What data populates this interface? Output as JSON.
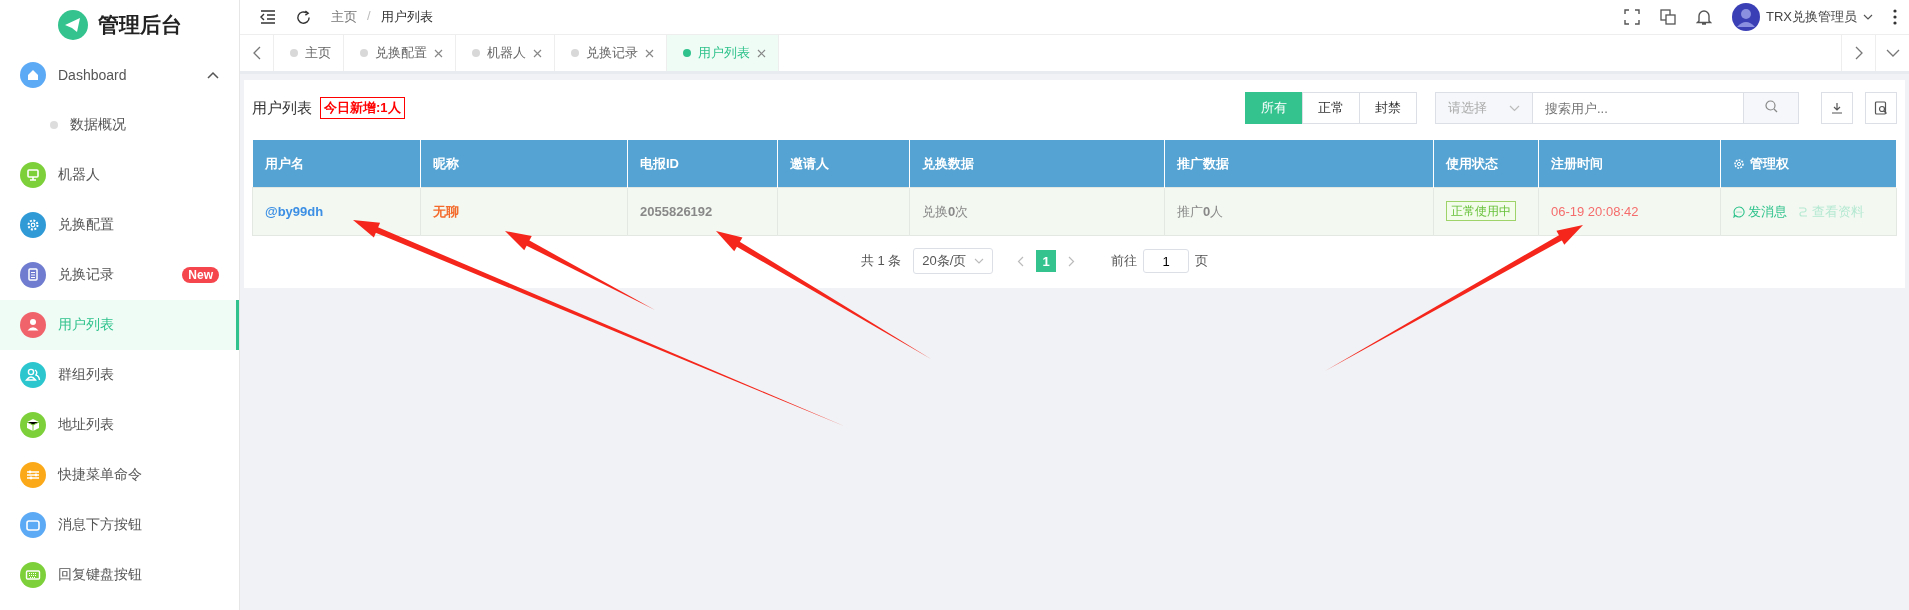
{
  "sidebar": {
    "logo": "管理后台",
    "items": [
      {
        "label": "Dashboard",
        "kind": "home",
        "color": "#5ca9f5",
        "selected": false,
        "expanded": true,
        "children": [
          {
            "label": "数据概况",
            "selected": false
          }
        ]
      },
      {
        "label": "机器人",
        "kind": "monitor",
        "color": "#7dd03a",
        "selected": false
      },
      {
        "label": "兑换配置",
        "kind": "gear",
        "color": "#2f9ad6",
        "selected": false
      },
      {
        "label": "兑换记录",
        "kind": "doc",
        "color": "#6f7ccf",
        "selected": false,
        "badge": "New"
      },
      {
        "label": "用户列表",
        "kind": "user",
        "color": "#f0636b",
        "selected": true
      },
      {
        "label": "群组列表",
        "kind": "users",
        "color": "#2cc6cf",
        "selected": false
      },
      {
        "label": "地址列表",
        "kind": "cube",
        "color": "#7dd03a",
        "selected": false
      },
      {
        "label": "快捷菜单命令",
        "kind": "sliders",
        "color": "#fba919",
        "selected": false
      },
      {
        "label": "消息下方按钮",
        "kind": "wallet",
        "color": "#5ca9f5",
        "selected": false
      },
      {
        "label": "回复键盘按钮",
        "kind": "keyboard",
        "color": "#7dd03a",
        "selected": false
      }
    ]
  },
  "header": {
    "breadcrumb": [
      "主页",
      "用户列表"
    ],
    "breadcrumb_separator": "/",
    "user": "TRX兑换管理员"
  },
  "tabs": [
    {
      "label": "主页",
      "closable": false,
      "selected": false
    },
    {
      "label": "兑换配置",
      "closable": true,
      "selected": false
    },
    {
      "label": "机器人",
      "closable": true,
      "selected": false
    },
    {
      "label": "兑换记录",
      "closable": true,
      "selected": false
    },
    {
      "label": "用户列表",
      "closable": true,
      "selected": true
    }
  ],
  "card": {
    "title": "用户列表",
    "badge": "今日新增:1人",
    "filters": [
      {
        "label": "所有",
        "selected": true
      },
      {
        "label": "正常",
        "selected": false
      },
      {
        "label": "封禁",
        "selected": false
      }
    ],
    "select": {
      "placeholder": "请选择"
    },
    "search": {
      "placeholder": "搜索用户..."
    }
  },
  "table": {
    "columns": [
      "用户名",
      "昵称",
      "电报ID",
      "邀请人",
      "兑换数据",
      "推广数据",
      "使用状态",
      "注册时间",
      "管理权"
    ],
    "rows": [
      {
        "username": "@by99dh",
        "nickname": "无聊",
        "telegram_id": "2055826192",
        "exchange": "兑换**0**次",
        "promotion": "推广**0**人",
        "status": "正常使用中",
        "registered": "06-19 20:08:42",
        "actions": [
          {
            "label": "发消息",
            "disabled": false
          },
          {
            "label": "查看资料",
            "disabled": true
          }
        ]
      }
    ]
  },
  "pagination": {
    "total": "共 1 条",
    "page_size": "20条/页",
    "pages": [
      {
        "label": "1",
        "selected": true
      }
    ],
    "goto_label": "前往",
    "goto_value": "1",
    "goto_suffix": "页"
  }
}
